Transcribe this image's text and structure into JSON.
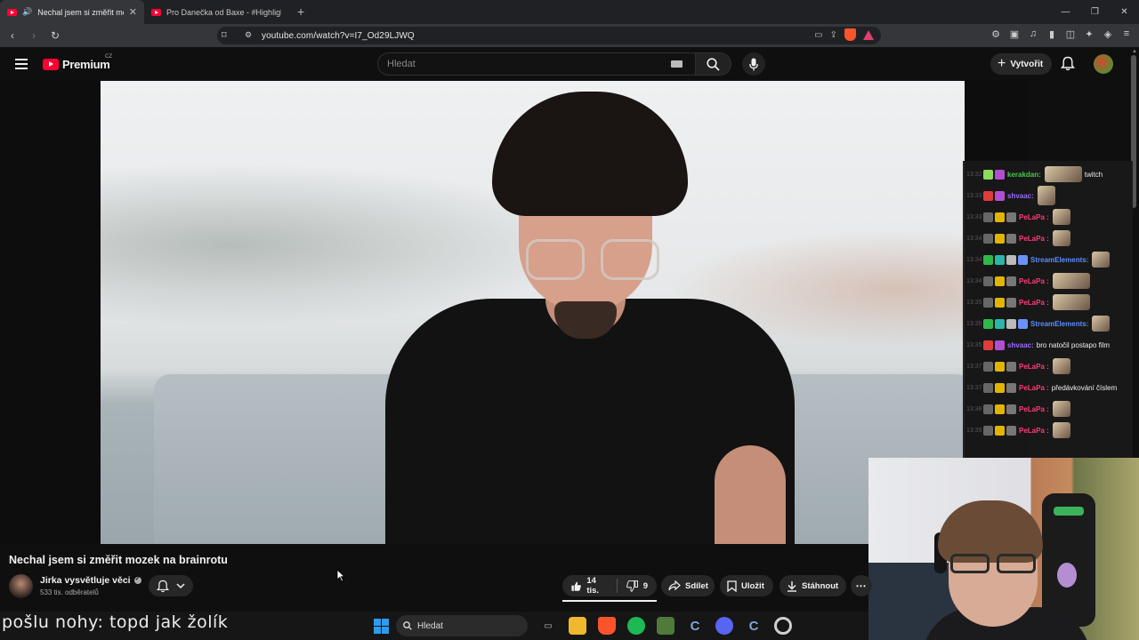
{
  "browser": {
    "tabs": [
      {
        "title": "Nechal jsem si změřit mozek",
        "active": true,
        "audio": true
      },
      {
        "title": "Pro Danečka od Baxe - #Highlights",
        "active": false,
        "audio": false
      }
    ],
    "new_tab": "+",
    "window_controls": [
      "—",
      "❐",
      "✕"
    ],
    "url": "youtube.com/watch?v=I7_Od29LJWQ"
  },
  "masthead": {
    "logo_text": "Premium",
    "country_code": "CZ",
    "search_placeholder": "Hledat",
    "create_label": "Vytvořit"
  },
  "chat": [
    {
      "ts": "13:32",
      "user": "kerakdan:",
      "user_color": "#4bc74b",
      "badges": [
        "#8bdc5b",
        "#b24fd1"
      ],
      "msg": "twitch",
      "emotes": [
        "wide"
      ]
    },
    {
      "ts": "13:33",
      "user": "shvaac:",
      "user_color": "#9a6bff",
      "badges": [
        "#e13c3c",
        "#b24fd1"
      ],
      "msg": "",
      "emotes": [
        "tall"
      ]
    },
    {
      "ts": "13:33",
      "user": "PeLaPa :",
      "user_color": "#ff3c78",
      "badges": [
        "#666",
        "#e2b400",
        "#777"
      ],
      "msg": "",
      "emotes": [
        "normal"
      ]
    },
    {
      "ts": "13:34",
      "user": "PeLaPa :",
      "user_color": "#ff3c78",
      "badges": [
        "#666",
        "#e2b400",
        "#777"
      ],
      "msg": "",
      "emotes": [
        "normal"
      ]
    },
    {
      "ts": "13:34",
      "user": "StreamElements:",
      "user_color": "#5b8cff",
      "badges": [
        "#2db84b",
        "#2ab7a9",
        "#bbb",
        "#6d8fff"
      ],
      "msg": "",
      "emotes": [
        "normal"
      ]
    },
    {
      "ts": "13:34",
      "user": "PeLaPa :",
      "user_color": "#ff3c78",
      "badges": [
        "#666",
        "#e2b400",
        "#777"
      ],
      "msg": "",
      "emotes": [
        "wide"
      ]
    },
    {
      "ts": "13:35",
      "user": "PeLaPa :",
      "user_color": "#ff3c78",
      "badges": [
        "#666",
        "#e2b400",
        "#777"
      ],
      "msg": "",
      "emotes": [
        "wide"
      ]
    },
    {
      "ts": "13:35",
      "user": "StreamElements:",
      "user_color": "#5b8cff",
      "badges": [
        "#2db84b",
        "#2ab7a9",
        "#bbb",
        "#6d8fff"
      ],
      "msg": "",
      "emotes": [
        "normal"
      ]
    },
    {
      "ts": "13:35",
      "user": "shvaac:",
      "user_color": "#9a6bff",
      "badges": [
        "#e13c3c",
        "#b24fd1"
      ],
      "msg": "bro natočil postapo film",
      "emotes": []
    },
    {
      "ts": "13:37",
      "user": "PeLaPa :",
      "user_color": "#ff3c78",
      "badges": [
        "#666",
        "#e2b400",
        "#777"
      ],
      "msg": "",
      "emotes": [
        "normal"
      ]
    },
    {
      "ts": "13:37",
      "user": "PeLaPa :",
      "user_color": "#ff3c78",
      "badges": [
        "#666",
        "#e2b400",
        "#777"
      ],
      "msg": "předávkování číslem",
      "emotes": []
    },
    {
      "ts": "13:38",
      "user": "PeLaPa :",
      "user_color": "#ff3c78",
      "badges": [
        "#666",
        "#e2b400",
        "#777"
      ],
      "msg": "",
      "emotes": [
        "normal"
      ]
    },
    {
      "ts": "13:39",
      "user": "PeLaPa :",
      "user_color": "#ff3c78",
      "badges": [
        "#666",
        "#e2b400",
        "#777"
      ],
      "msg": "",
      "emotes": [
        "normal"
      ]
    }
  ],
  "video": {
    "title": "Nechal jsem si změřit mozek na brainrotu",
    "channel": "Jirka vysvětluje věci",
    "subscribers": "533 tis. odběratelů",
    "likes": "14 tis.",
    "dislikes": "9",
    "share_label": "Sdílet",
    "save_label": "Uložit",
    "download_label": "Stáhnout"
  },
  "overlay": {
    "caption": "pošlu nohy: topd jak žolík"
  },
  "taskbar": {
    "search_placeholder": "Hledat",
    "apps": [
      "task-view-icon",
      "file-explorer-icon",
      "brave-icon",
      "spotify-icon",
      "minecraft-icon",
      "ccleaner-icon",
      "discord-icon",
      "ccleaner-icon",
      "chrome-icon"
    ]
  },
  "colors": {
    "youtube_red": "#ff0033",
    "background": "#0f0f0f",
    "pill": "#272727"
  }
}
